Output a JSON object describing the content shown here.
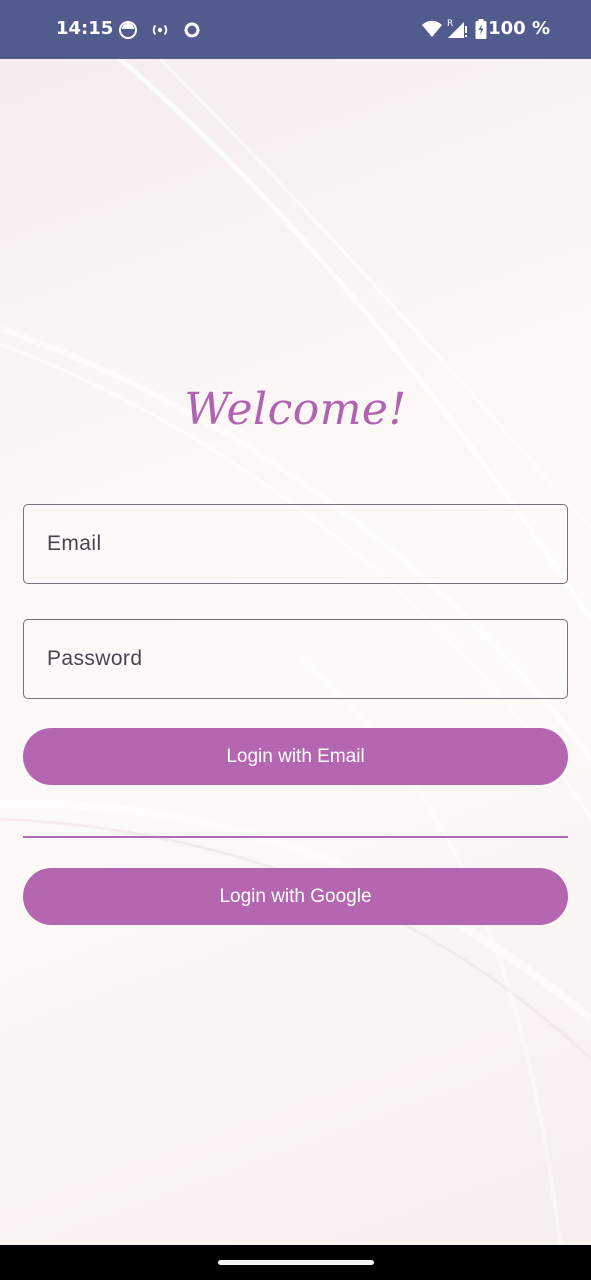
{
  "status_bar": {
    "time": "14:15",
    "battery": "100 %",
    "icons": [
      "notification-app-icon",
      "hotspot-icon",
      "circle-status-icon",
      "wifi-icon",
      "signal-roaming-icon",
      "battery-charging-icon"
    ]
  },
  "login": {
    "title": "Welcome!",
    "email_placeholder": "Email",
    "password_placeholder": "Password",
    "email_button": "Login with Email",
    "google_button": "Login with Google"
  },
  "colors": {
    "status_bar": "#525b8e",
    "accent": "#b466b0",
    "title": "#b064b0",
    "field_border": "#76707a"
  }
}
